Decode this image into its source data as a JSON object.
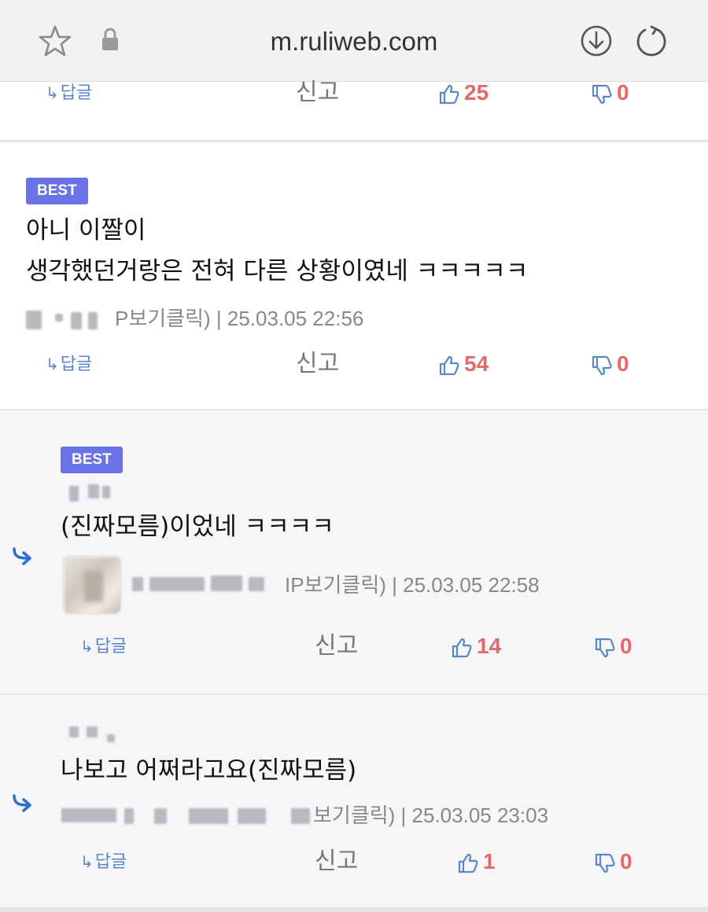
{
  "browser": {
    "url": "m.ruliweb.com",
    "icons": [
      "star-icon",
      "lock-icon",
      "download-icon",
      "reload-icon"
    ]
  },
  "labels": {
    "reply": "답글",
    "report": "신고",
    "best": "BEST"
  },
  "comments": [
    {
      "likes": "25",
      "dislikes": "0"
    },
    {
      "best": true,
      "text_lines": [
        "아니 이짤이",
        "생각했던거랑은 전혀 다른 상황이였네 ㅋㅋㅋㅋㅋ"
      ],
      "meta_visible": "P보기클릭) | 25.03.05 22:56",
      "likes": "54",
      "dislikes": "0"
    },
    {
      "best": true,
      "is_reply": true,
      "text_lines": [
        "(진짜모름)이었네 ㅋㅋㅋㅋ"
      ],
      "meta_visible": "IP보기클릭) | 25.03.05 22:58",
      "likes": "14",
      "dislikes": "0"
    },
    {
      "is_reply": true,
      "text_lines": [
        "나보고 어쩌라고요(진짜모름)"
      ],
      "meta_visible": "보기클릭) | 25.03.05 23:03",
      "likes": "1",
      "dislikes": "0"
    }
  ],
  "colors": {
    "best_badge": "#6a73e6",
    "like_count": "#e26a6a",
    "thumb_icon": "#5b86c6",
    "reply_arrow": "#2a6fd1"
  }
}
